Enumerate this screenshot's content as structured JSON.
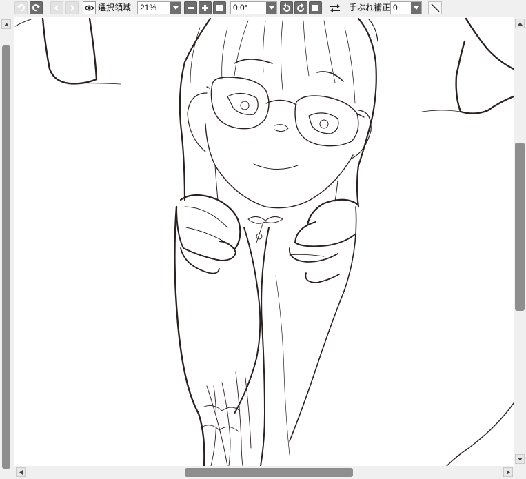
{
  "toolbar": {
    "buttons": {
      "undo": "undo-icon",
      "redo": "redo-icon",
      "back": "back-icon",
      "forward": "forward-icon",
      "show_selection": "eye-icon",
      "zoom_out": "minus-icon",
      "zoom_in": "plus-icon",
      "zoom_reset": "square-icon",
      "rotate_left": "rotate-left-icon",
      "rotate_right": "rotate-right-icon",
      "rotate_reset": "square-icon",
      "flip": "flip-horizontal-icon",
      "line": "line-tool-icon"
    },
    "selection_label": "選択領域",
    "zoom_value": "21%",
    "rotation_value": "0.0°",
    "stabilizer_label": "手ぶれ補正",
    "stabilizer_value": "0"
  },
  "colors": {
    "toolbar_bg": "#f0f0f0",
    "button_dark": "#6e6e6e",
    "canvas_bg": "#ffffff",
    "line_art": "#2a2220",
    "scrollbar_thumb": "#8e8e8e"
  },
  "canvas": {
    "content": "line-art illustration"
  }
}
